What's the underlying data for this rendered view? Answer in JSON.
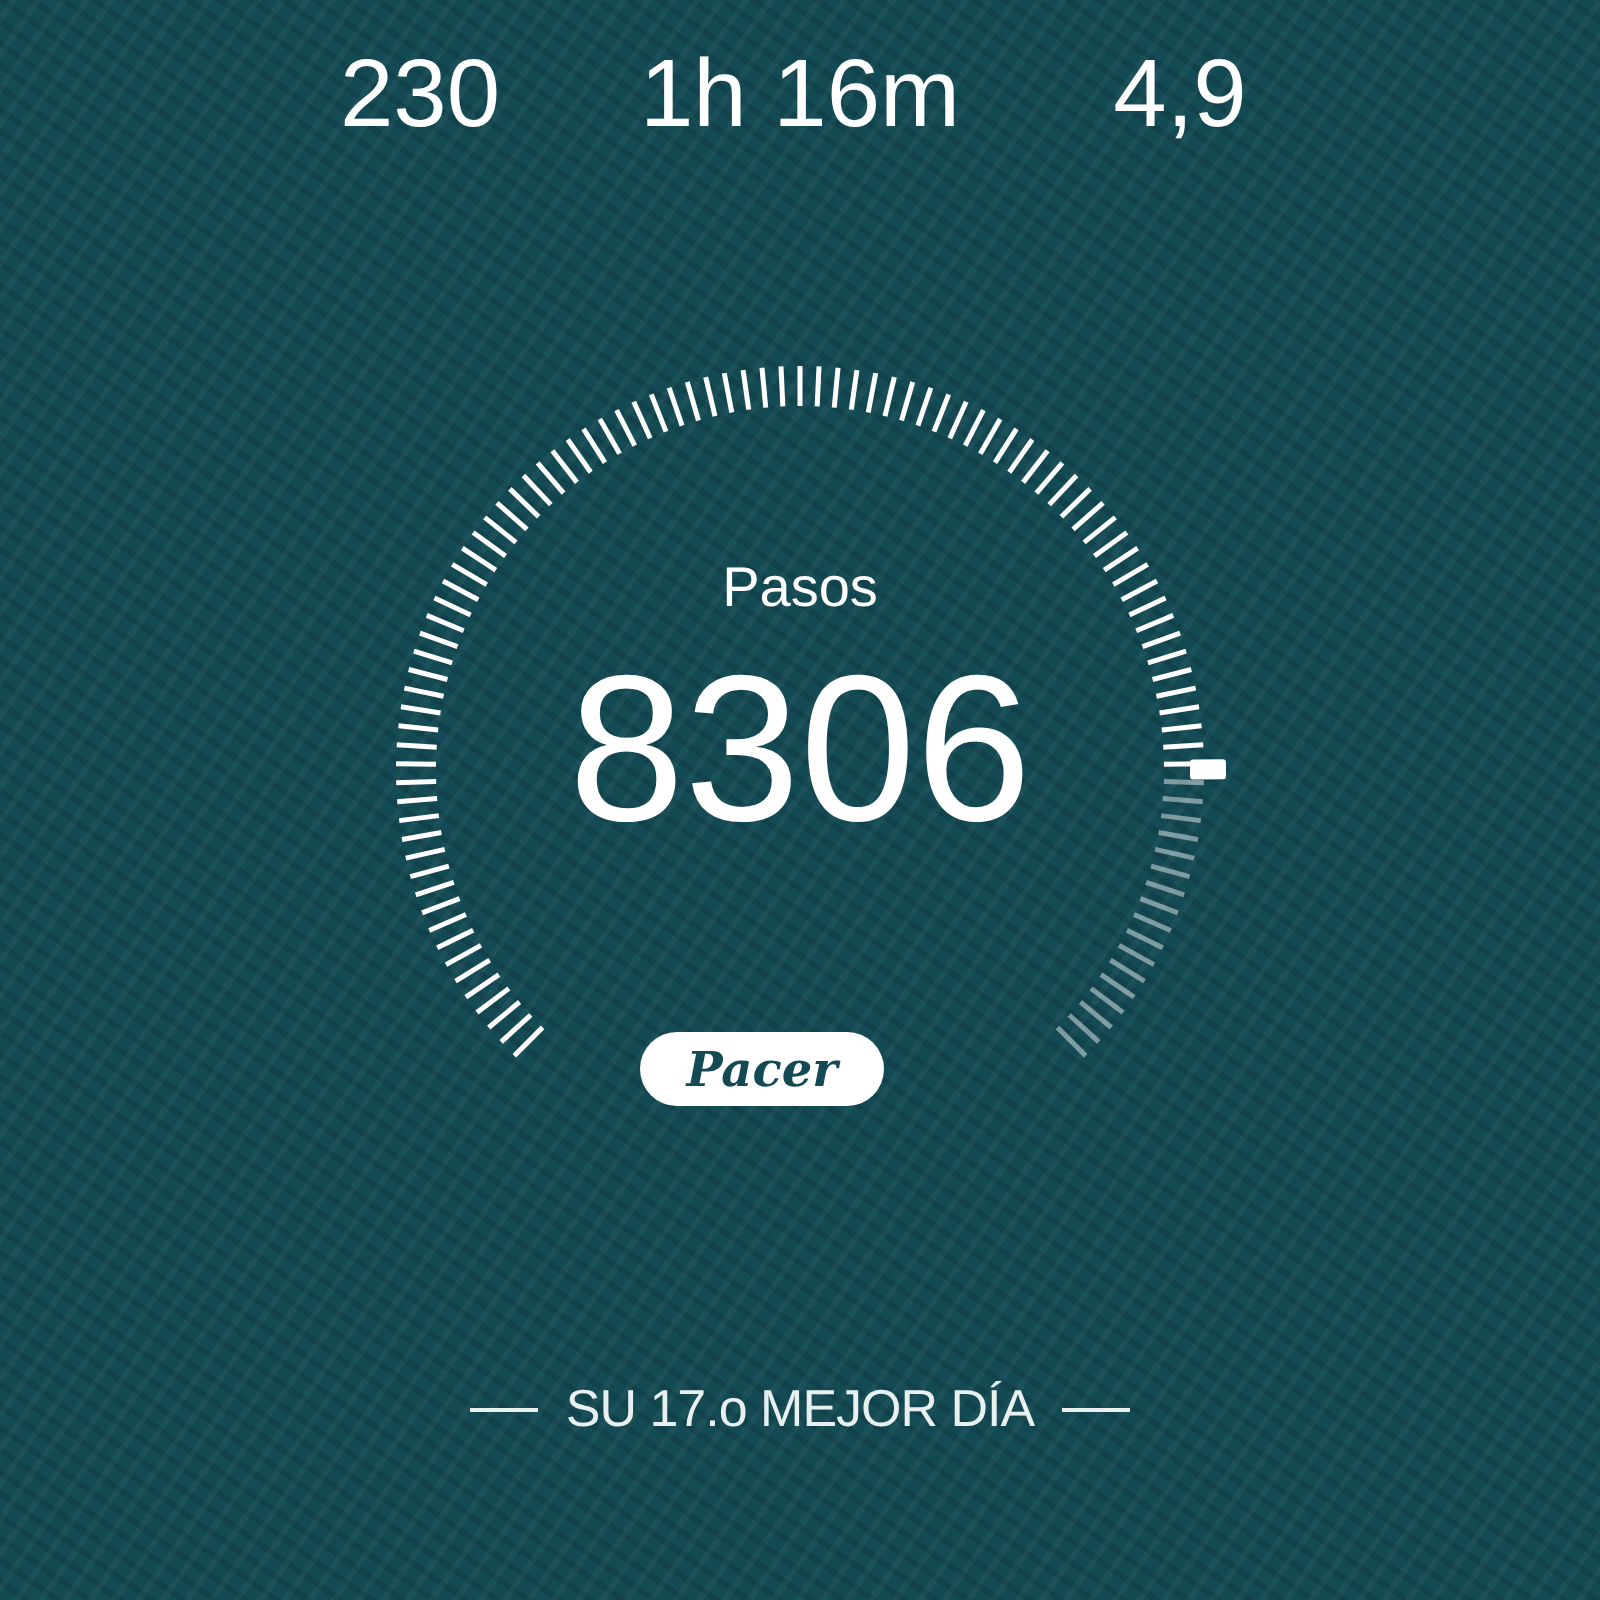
{
  "stats": [
    {
      "value": "230"
    },
    {
      "value": "1h 16m"
    },
    {
      "value": "4,9"
    }
  ],
  "gauge": {
    "label": "Pasos",
    "value": "8306"
  },
  "logo": {
    "text": "Pacer"
  },
  "footer": {
    "text": "SU 17.o MEJOR DÍA"
  }
}
